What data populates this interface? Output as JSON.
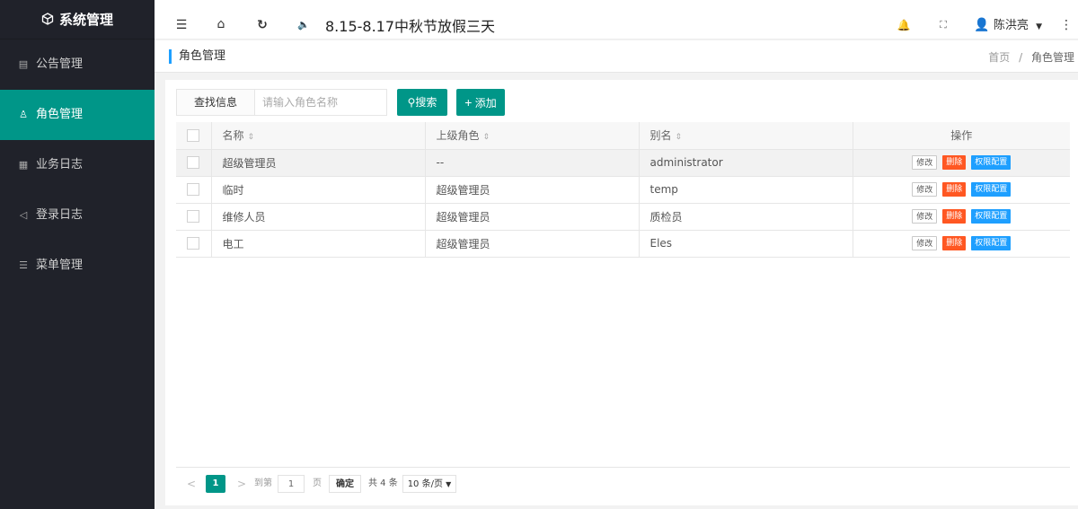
{
  "sidebar": {
    "logo": "系统管理",
    "items": [
      {
        "label": "公告管理",
        "icon": "document-icon"
      },
      {
        "label": "角色管理",
        "icon": "user-icon"
      },
      {
        "label": "业务日志",
        "icon": "calendar-icon"
      },
      {
        "label": "登录日志",
        "icon": "send-icon"
      },
      {
        "label": "菜单管理",
        "icon": "list-icon"
      }
    ],
    "active_index": 1,
    "colors": {
      "bg": "#20222a",
      "active": "#009688"
    }
  },
  "header": {
    "notice": "8.15-8.17中秋节放假三天",
    "user": "陈洪亮"
  },
  "breadcrumb": {
    "title": "角色管理",
    "home": "首页",
    "separator": "/",
    "current": "角色管理"
  },
  "toolbar": {
    "label": "查找信息",
    "search_placeholder": "请输入角色名称",
    "search_button": "搜索",
    "add_button": "添加"
  },
  "table": {
    "headers": {
      "name": "名称",
      "parent": "上级角色",
      "alias": "别名",
      "ops": "操作"
    },
    "rows": [
      {
        "name": "超级管理员",
        "parent": "--",
        "alias": "administrator"
      },
      {
        "name": "临时",
        "parent": "超级管理员",
        "alias": "temp"
      },
      {
        "name": "维修人员",
        "parent": "超级管理员",
        "alias": "质检员"
      },
      {
        "name": "电工",
        "parent": "超级管理员",
        "alias": "Eles"
      }
    ],
    "op_labels": {
      "edit": "修改",
      "delete": "删除",
      "perm": "权限配置"
    }
  },
  "pager": {
    "prev": "<",
    "current_page": "1",
    "next": ">",
    "goto_label": "到第",
    "goto_value": "1",
    "page_unit": "页",
    "confirm": "确定",
    "total": "共 4 条",
    "page_size": "10 条/页"
  }
}
